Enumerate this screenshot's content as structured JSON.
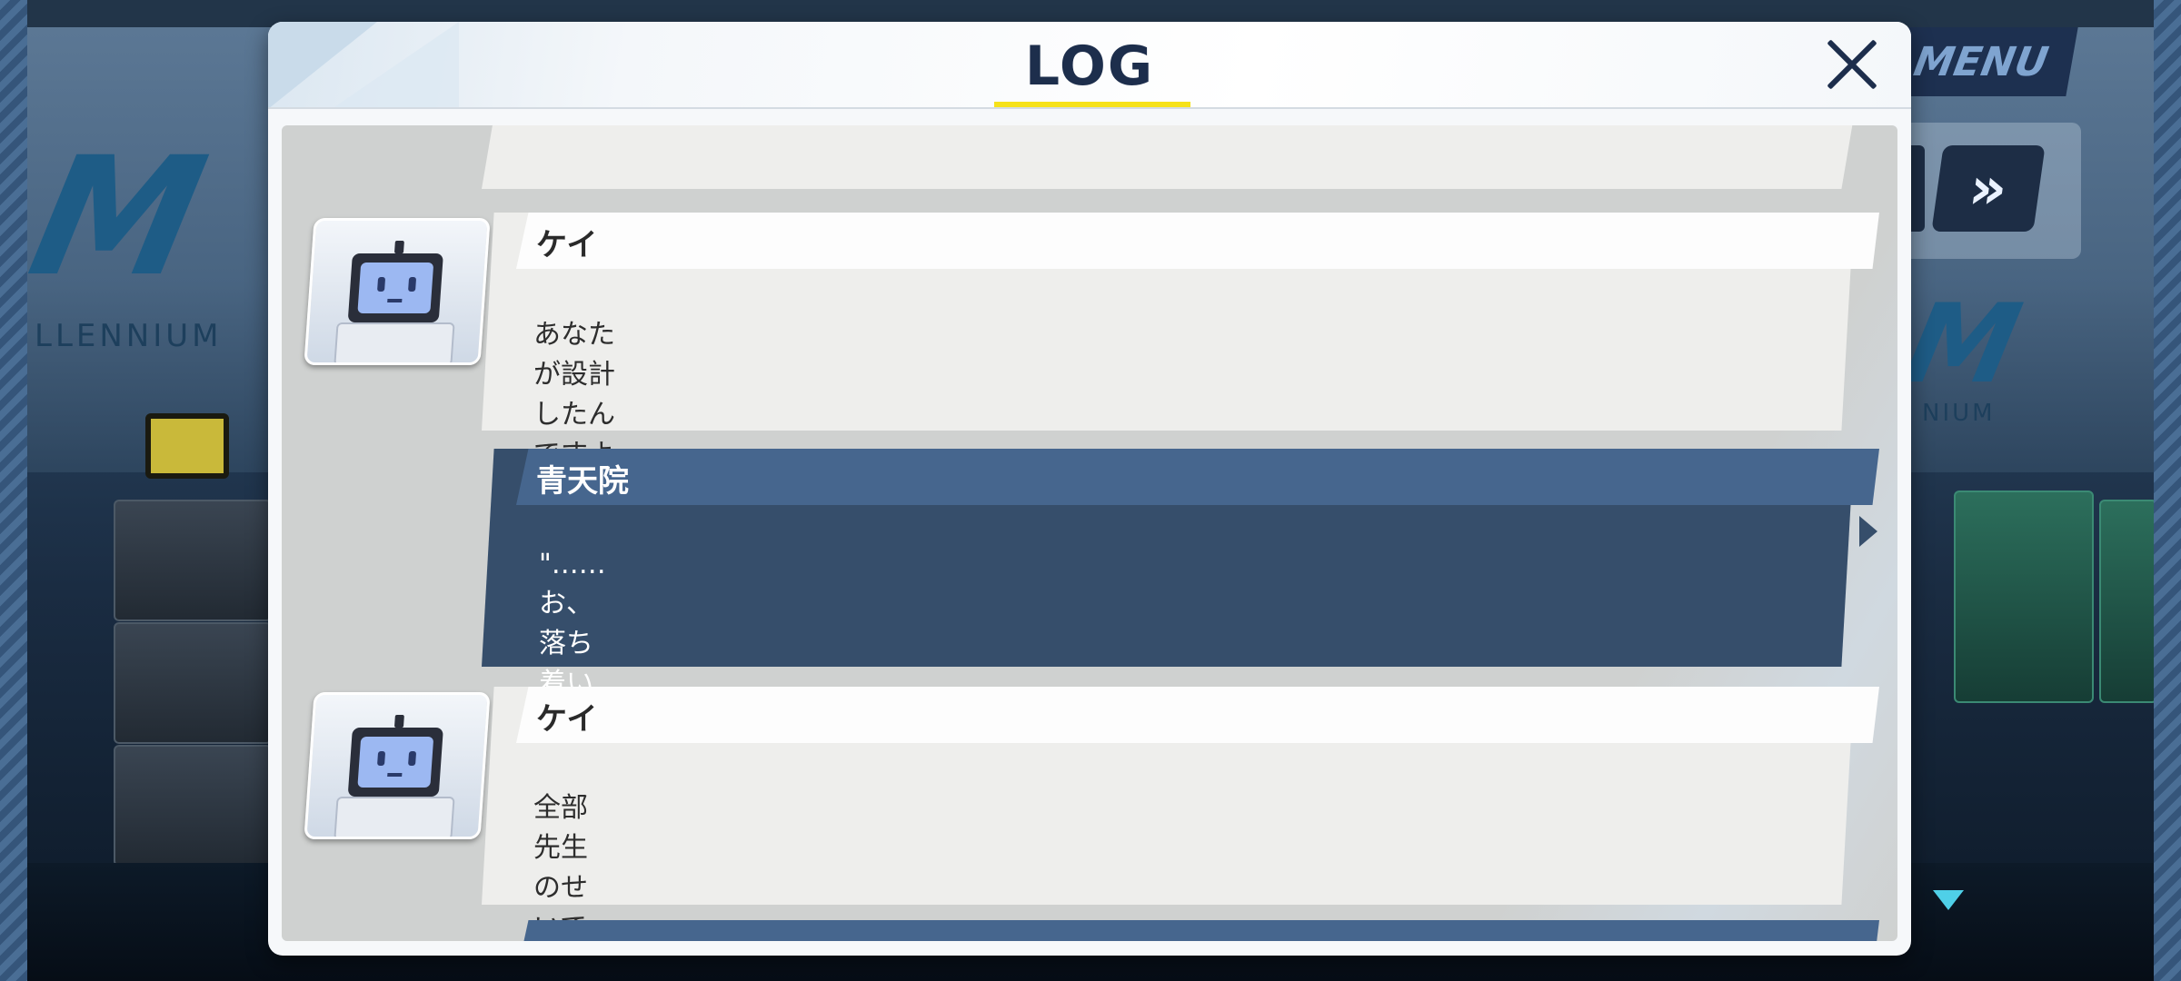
{
  "hud": {
    "menu_label": "MENU",
    "skip_glyph": "»",
    "scene_logo_text_left": "LLENNIUM",
    "scene_logo_text_right": "NIUM"
  },
  "dialog": {
    "title": "LOG"
  },
  "log": {
    "entries": [
      {
        "speaker": "",
        "text": "",
        "type": "npc"
      },
      {
        "speaker": "ケイ",
        "text": "あなたが設計したんですよね！？",
        "type": "npc",
        "avatar": "robot-avatar"
      },
      {
        "speaker": "青天院",
        "text": "\"……お、落ち着いて、ケイ。\"",
        "type": "player"
      },
      {
        "speaker": "ケイ",
        "text": "全部先生のせいです！",
        "type": "npc",
        "avatar": "robot-avatar"
      },
      {
        "speaker": "",
        "text": "",
        "type": "player"
      }
    ]
  },
  "colors": {
    "title_underline": "#f6e21a",
    "npc_bubble": "#eeeeec",
    "player_bubble": "#364e6b",
    "player_nameplate": "#46668e",
    "menu_text": "#7fa4d0"
  }
}
